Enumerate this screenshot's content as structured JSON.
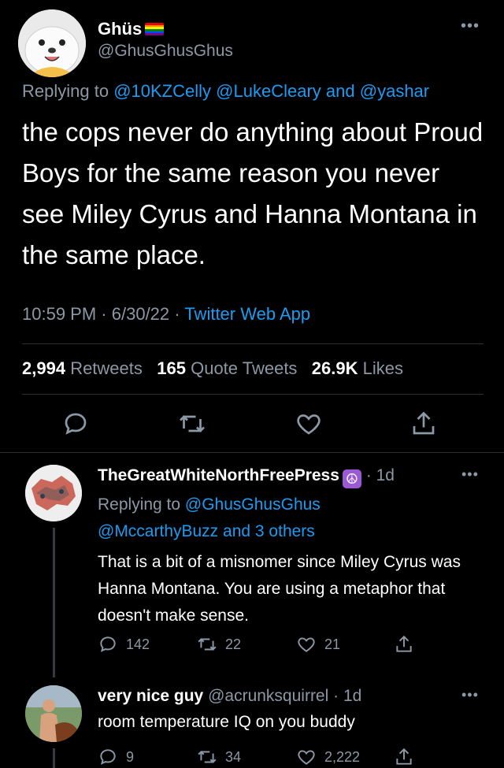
{
  "main_tweet": {
    "author_name": "Ghüs",
    "author_handle": "@GhusGhusGhus",
    "replying_label": "Replying to",
    "replying_to": [
      "@10KZCelly",
      "@LukeCleary"
    ],
    "replying_and": "and",
    "replying_last": "@yashar",
    "text": "the cops never do anything about Proud Boys for the same reason you never see Miley Cyrus and Hanna Montana in the same place.",
    "time": "10:59 PM",
    "date": "6/30/22",
    "source": "Twitter Web App",
    "retweets_count": "2,994",
    "retweets_label": "Retweets",
    "quotes_count": "165",
    "quotes_label": "Quote Tweets",
    "likes_count": "26.9K",
    "likes_label": "Likes",
    "more_icon": "more-horizontal-icon"
  },
  "replies": [
    {
      "author_name": "TheGreatWhiteNorthFreePress",
      "badge_icon": "peace-sign-icon",
      "age": "1d",
      "replying_label": "Replying to",
      "replying_to": "@GhusGhusGhus",
      "replying_to_2": "@MccarthyBuzz",
      "replying_and": "and",
      "replying_others": "3 others",
      "text": "That is a bit of a misnomer since Miley Cyrus was Hanna Montana. You are using a metaphor that doesn't make sense.",
      "reply_count": "142",
      "retweet_count": "22",
      "like_count": "21"
    },
    {
      "author_name": "very nice guy",
      "author_handle": "@acrunksquirrel",
      "age": "1d",
      "text": "room temperature IQ on you buddy",
      "reply_count": "9",
      "retweet_count": "34",
      "like_count": "2,222"
    }
  ],
  "colors": {
    "background": "#000000",
    "link": "#1d9bf0",
    "muted": "#8b98a5",
    "text": "#e7e9ea"
  }
}
